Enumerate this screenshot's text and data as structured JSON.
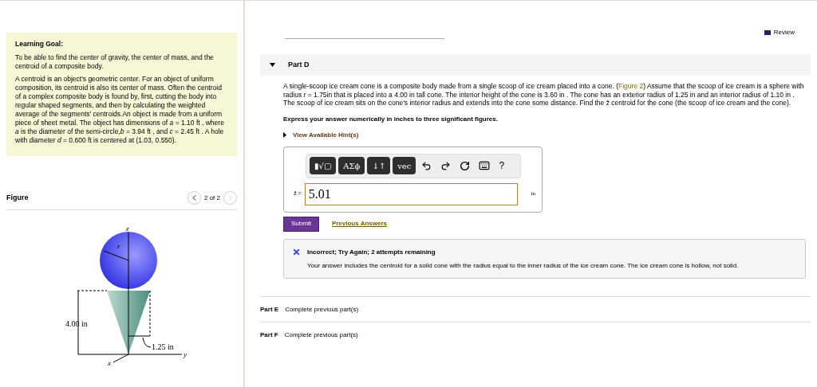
{
  "learning_goal": {
    "title": "Learning Goal:",
    "paragraphs": [
      "To be able to find the center of gravity, the center of mass, and the centroid of a composite body.",
      "A centroid is an object's geometric center. For an object of uniform composition, its centroid is also its center of mass. Often the centroid of a complex composite body is found by, first, cutting the body into regular shaped segments, and then by calculating the weighted average of the segments' centroids.An object is made from a uniform piece of sheet metal. The object has dimensions of *a* = 1.10 ft , where *a* is the diameter of the semi-circle,*b* = 3.94 ft , and *c* = 2.45 ft . A hole with diameter *d* = 0.600 ft is centered at (1.03, 0.550)."
    ]
  },
  "figure": {
    "title": "Figure",
    "pager": "2 of 2",
    "prev_disabled": false,
    "next_disabled": true,
    "labels": {
      "z": "z",
      "y": "y",
      "x": "x",
      "r": "r",
      "height": "4.00 in",
      "radius": "1.25 in"
    }
  },
  "review": "Review",
  "part_d": {
    "title": "Part D",
    "expanded": true,
    "text": "A single-scoop ice cream cone is a composite body made from a single scoop of ice cream placed into a cone. (",
    "figure_link": "Figure 2",
    "text_after": ") Assume that the scoop of ice cream is a sphere with radius *r* = 1.75in that is placed into a 4.00 in tall cone. The interior height of the cone is 3.60 in . The cone has an exterior radius of 1.25 in and an interior radius of 1.10 in . The scoop of ice cream sits on the cone's interior radius and extends into the cone some distance. Find the z̄ centroid for the cone (the scoop of ice cream and the cone).",
    "instruction": "Express your answer numerically in inches to three significant figures.",
    "hint": "View Available Hint(s)",
    "toolbar": [
      {
        "kind": "template",
        "label": "▮√▢"
      },
      {
        "kind": "greek",
        "label": "ΑΣϕ"
      },
      {
        "kind": "arrows",
        "label": "↓↑"
      },
      {
        "kind": "vec",
        "label": "vec"
      },
      {
        "kind": "undo"
      },
      {
        "kind": "redo"
      },
      {
        "kind": "reset"
      },
      {
        "kind": "keyboard"
      },
      {
        "kind": "help",
        "label": "?"
      }
    ],
    "answer_label": "z̄ =",
    "answer": "5.01",
    "unit": "in",
    "submit": "Submit",
    "previous": "Previous Answers",
    "feedback": {
      "title": "Incorrect; Try Again; 2 attempts remaining",
      "message": "Your answer includes the centroid for a solid cone with the radius equal to the inner radius of the ice cream cone. The ice cream cone is hollow, not solid."
    }
  },
  "other_parts": [
    {
      "title": "Part E",
      "status": "Complete previous part(s)"
    },
    {
      "title": "Part F",
      "status": "Complete previous part(s)"
    }
  ]
}
